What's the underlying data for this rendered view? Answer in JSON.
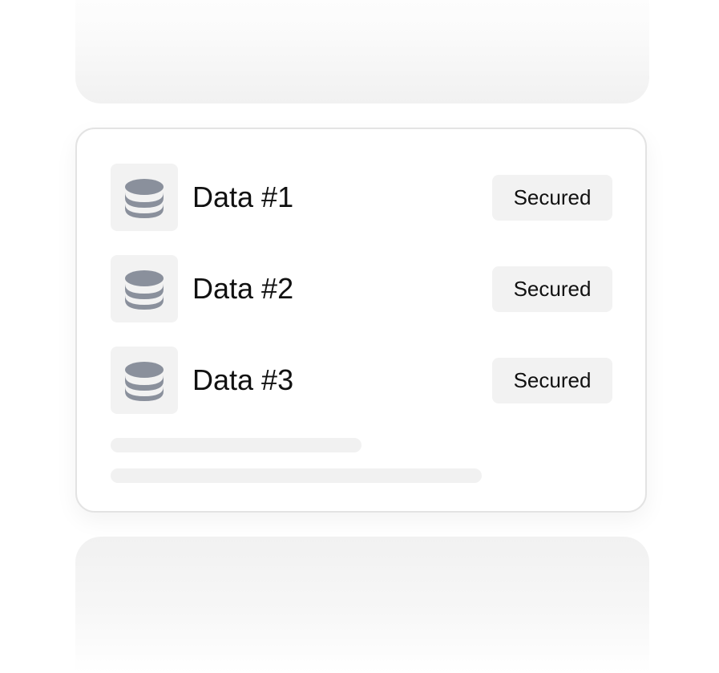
{
  "rows": [
    {
      "label": "Data #1",
      "status": "Secured",
      "icon": "database-icon"
    },
    {
      "label": "Data #2",
      "status": "Secured",
      "icon": "database-icon"
    },
    {
      "label": "Data #3",
      "status": "Secured",
      "icon": "database-icon"
    }
  ],
  "colors": {
    "icon": "#8a909c",
    "icon_bg": "#f2f2f2",
    "badge_bg": "#f2f2f2",
    "card_border": "#e3e3e3",
    "text": "#111111",
    "placeholder": "#f1f1f1"
  }
}
